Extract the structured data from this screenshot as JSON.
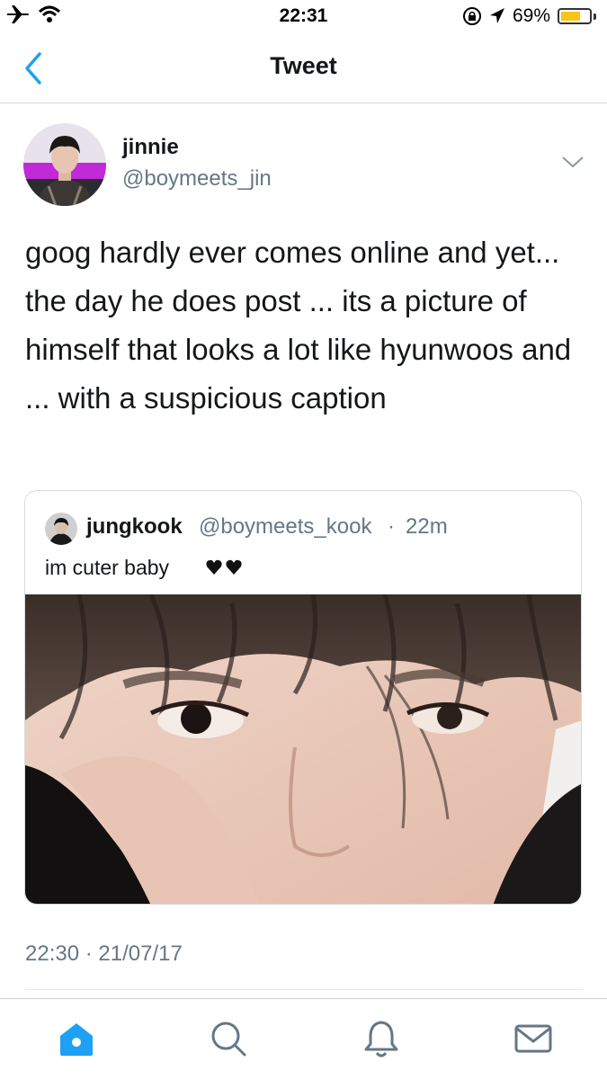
{
  "status": {
    "time": "22:31",
    "battery": "69%",
    "battery_level": 0.69
  },
  "nav": {
    "title": "Tweet",
    "back_icon": "chevron-left-icon"
  },
  "tweet": {
    "name": "jinnie",
    "handle": "@boymeets_jin",
    "text": "goog hardly ever comes online and yet... the day he does post ... its a picture of himself that looks a lot like hyunwoos and ... with a suspicious caption",
    "timestamp": "22:30 · 21/07/17"
  },
  "quoted": {
    "name": "jungkook",
    "handle": "@boymeets_kook",
    "separator": "·",
    "time": "22m",
    "text": "im cuter baby"
  },
  "tabs": [
    {
      "icon": "home-icon",
      "active": true
    },
    {
      "icon": "search-icon",
      "active": false
    },
    {
      "icon": "notifications-bell-icon",
      "active": false
    },
    {
      "icon": "messages-envelope-icon",
      "active": false
    }
  ],
  "colors": {
    "accent": "#1da1f2",
    "secondary_text": "#657786",
    "battery": "#f6c515"
  }
}
